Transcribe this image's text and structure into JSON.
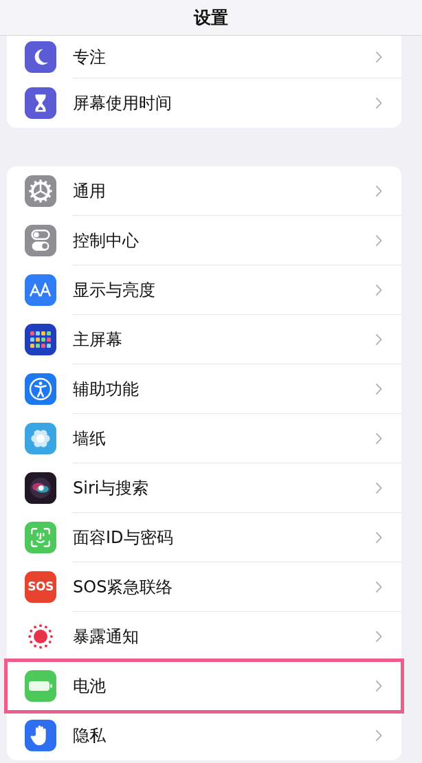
{
  "nav_bar": {
    "title": "设置"
  },
  "groups": [
    {
      "items": [
        {
          "label": "专注",
          "highlighted": false
        },
        {
          "label": "屏幕使用时间",
          "highlighted": false
        }
      ]
    },
    {
      "items": [
        {
          "label": "通用",
          "highlighted": false
        },
        {
          "label": "控制中心",
          "highlighted": false
        },
        {
          "label": "显示与亮度",
          "highlighted": false
        },
        {
          "label": "主屏幕",
          "highlighted": false
        },
        {
          "label": "辅助功能",
          "highlighted": false
        },
        {
          "label": "墙纸",
          "highlighted": false
        },
        {
          "label": "Siri与搜索",
          "highlighted": false
        },
        {
          "label": "面容ID与密码",
          "highlighted": false
        },
        {
          "label": "SOS紧急联络",
          "icon_label": "SOS",
          "highlighted": false
        },
        {
          "label": "暴露通知",
          "highlighted": false
        },
        {
          "label": "电池",
          "highlighted": true
        },
        {
          "label": "隐私",
          "highlighted": false
        }
      ]
    }
  ]
}
